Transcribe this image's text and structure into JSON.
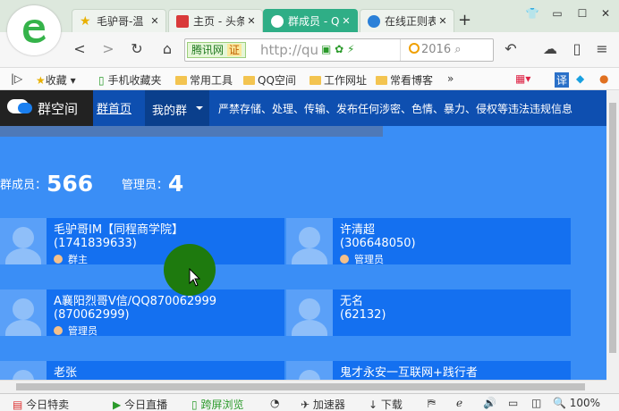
{
  "tabs": [
    {
      "title": "毛驴哥-温",
      "active": false,
      "icon": "star-icon"
    },
    {
      "title": "主页 - 头条",
      "active": false,
      "icon": "toutiao-icon"
    },
    {
      "title": "群成员 - Q",
      "active": true,
      "icon": "qq-group-icon"
    },
    {
      "title": "在线正则表",
      "active": false,
      "icon": "globe-icon"
    }
  ],
  "toolbar": {
    "site_label": "腾讯网",
    "cert_label": "证",
    "url": "http://qu",
    "search_text": "2016"
  },
  "bookmarks": [
    "收藏",
    "手机收藏夹",
    "常用工具",
    "QQ空间",
    "工作网址",
    "常看博客"
  ],
  "bookmark_more": "»",
  "extension_label": "译",
  "page": {
    "logo_text": "群空间",
    "nav": {
      "home": "群首页",
      "mygroup": "我的群"
    },
    "warning": "严禁存储、处理、传输、发布任何涉密、色情、暴力、侵权等违法违规信息",
    "stats": {
      "members_label": "群成员：",
      "members": "566",
      "admins_label": "管理员：",
      "admins": "4"
    },
    "members": [
      {
        "name": "毛驴哥IM【同程商学院】",
        "qq": "(1741839633)",
        "role": "群主"
      },
      {
        "name": "许清超",
        "qq": "(306648050)",
        "role": "管理员"
      },
      {
        "name": "A襄阳烈哥V信/QQ870062999",
        "qq": "(870062999)",
        "role": "管理员"
      },
      {
        "name": "无名",
        "qq": "(62132)",
        "role": ""
      },
      {
        "name": "老张",
        "qq": "",
        "role": ""
      },
      {
        "name": "鬼才永安一互联网+践行者",
        "qq": "",
        "role": ""
      }
    ]
  },
  "statusbar": {
    "deals": "今日特卖",
    "live": "今日直播",
    "cross": "跨屏浏览",
    "accel": "加速器",
    "download": "下载",
    "zoom": "100%"
  },
  "colors": {
    "tab_active": "#2fae86",
    "page_bg": "#3a8ef6",
    "nav_bg": "#0e4fb0",
    "card_bg": "#1470f0"
  }
}
